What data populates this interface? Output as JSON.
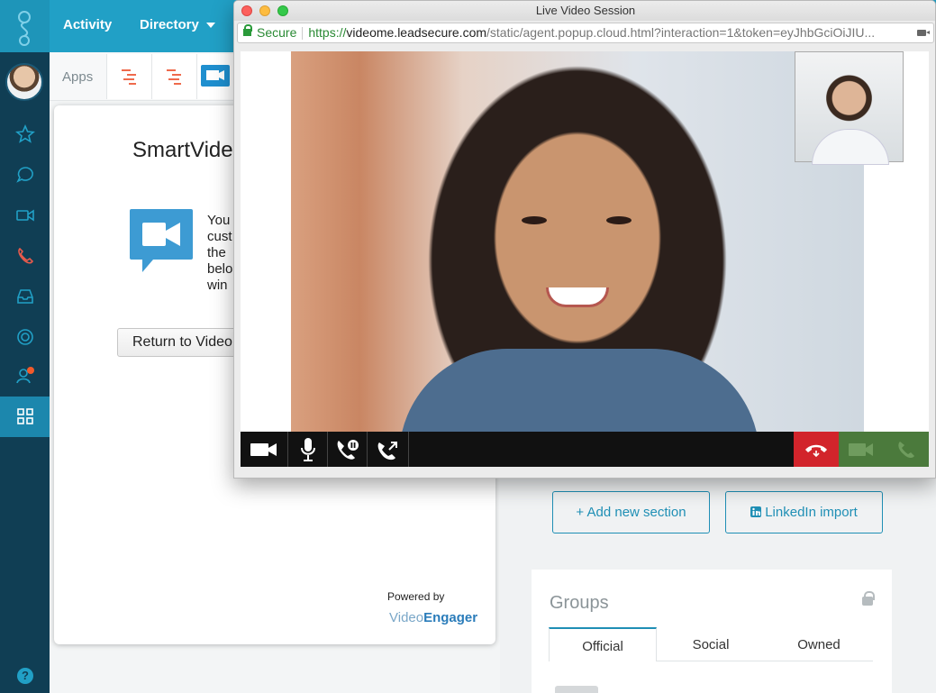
{
  "topnav": {
    "activity": "Activity",
    "directory": "Directory"
  },
  "apps_strip": {
    "label": "Apps"
  },
  "smartvideo": {
    "title": "SmartVide",
    "text_lines": "You\ncust\nthe\nbelo\nwin",
    "button": "Return to Video",
    "powered_by": "Powered by",
    "logo_video": "Video",
    "logo_engager": "Engager"
  },
  "popup": {
    "title": "Live Video Session",
    "secure": "Secure",
    "url_scheme": "https://",
    "url_host": "videome.leadsecure.com",
    "url_rest": "/static/agent.popup.cloud.html?interaction=1&token=eyJhbGciOiJIU..."
  },
  "profile": {
    "add_section": "+ Add new section",
    "linkedin_import": "LinkedIn import",
    "groups_title": "Groups",
    "tabs": [
      "Official",
      "Social",
      "Owned"
    ]
  },
  "colors": {
    "brand": "#21a0c6",
    "sidebar": "#103e54",
    "hangup": "#d2242b",
    "green": "#4b7a3c"
  }
}
